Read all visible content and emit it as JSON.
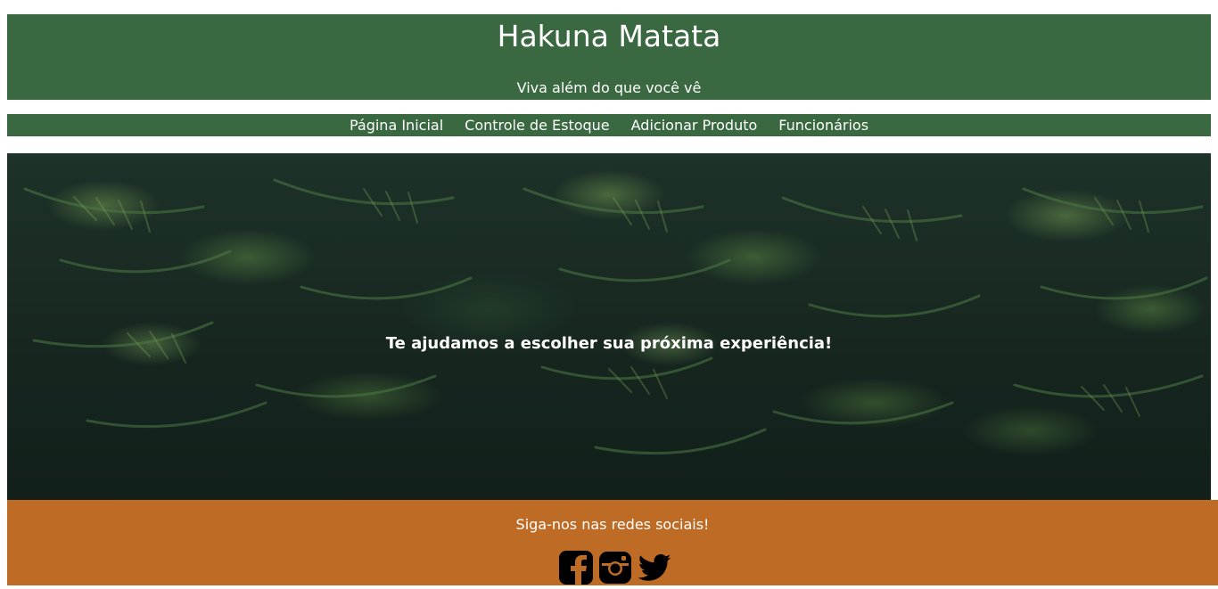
{
  "header": {
    "title": "Hakuna Matata",
    "subtitle": "Viva além do que você vê"
  },
  "nav": {
    "items": [
      {
        "label": "Página Inicial"
      },
      {
        "label": "Controle de Estoque"
      },
      {
        "label": "Adicionar Produto"
      },
      {
        "label": "Funcionários"
      }
    ]
  },
  "hero": {
    "text": "Te ajudamos a escolher sua próxima experiência!"
  },
  "footer": {
    "text": "Siga-nos nas redes sociais!",
    "social": [
      {
        "icon": "facebook-icon"
      },
      {
        "icon": "instagram-icon"
      },
      {
        "icon": "twitter-icon"
      }
    ]
  },
  "colors": {
    "header_bg": "#396841",
    "footer_bg": "#bd6b25",
    "text": "#ffffff"
  }
}
